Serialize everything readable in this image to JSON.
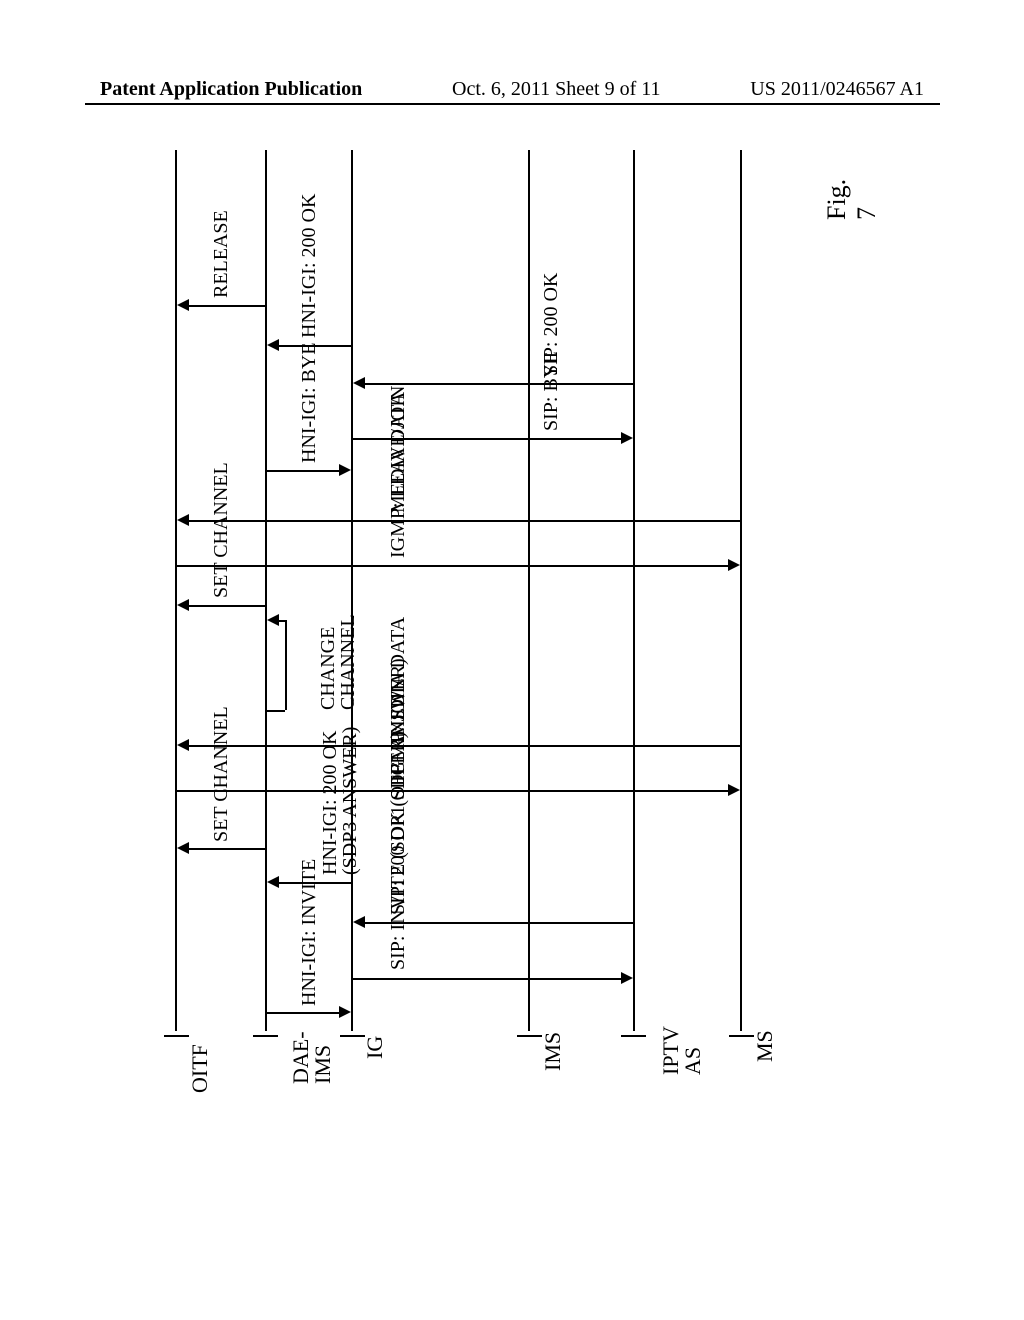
{
  "header": {
    "left": "Patent Application Publication",
    "center": "Oct. 6, 2011  Sheet 9 of 11",
    "right": "US 2011/0246567 A1"
  },
  "actors": {
    "oitf": "OITF",
    "dae_ims": "DAE-\nIMS",
    "ig": "IG",
    "ims": "IMS",
    "iptv_as": "IPTV\nAS",
    "ms": "MS"
  },
  "messages": {
    "m1": "HNI-IGI: INVITE",
    "m2": "SIP: INVITE (SDP1 OFFER)",
    "m3": "SIP: 200 OK (SDP1 ANSWER)",
    "m4": "HNI-IGI: 200 OK\n(SDP3 ANSWER)",
    "m5": "SET CHANNEL",
    "m6": "IGMP: JOIN",
    "m7": "MEDIA DATA",
    "m8": "CHANGE\nCHANNEL",
    "m9": "SET CHANNEL",
    "m10": "IGMP: LEAVE/JOIN",
    "m11": "MEDIA DATA",
    "m12": "HNI-IGI: BYE",
    "m13": "SIP: BYE",
    "m14": "SIP: 200 OK",
    "m15": "HNI-IGI: 200 OK",
    "m16": "RELEASE"
  },
  "figure_label": "Fig. 7"
}
